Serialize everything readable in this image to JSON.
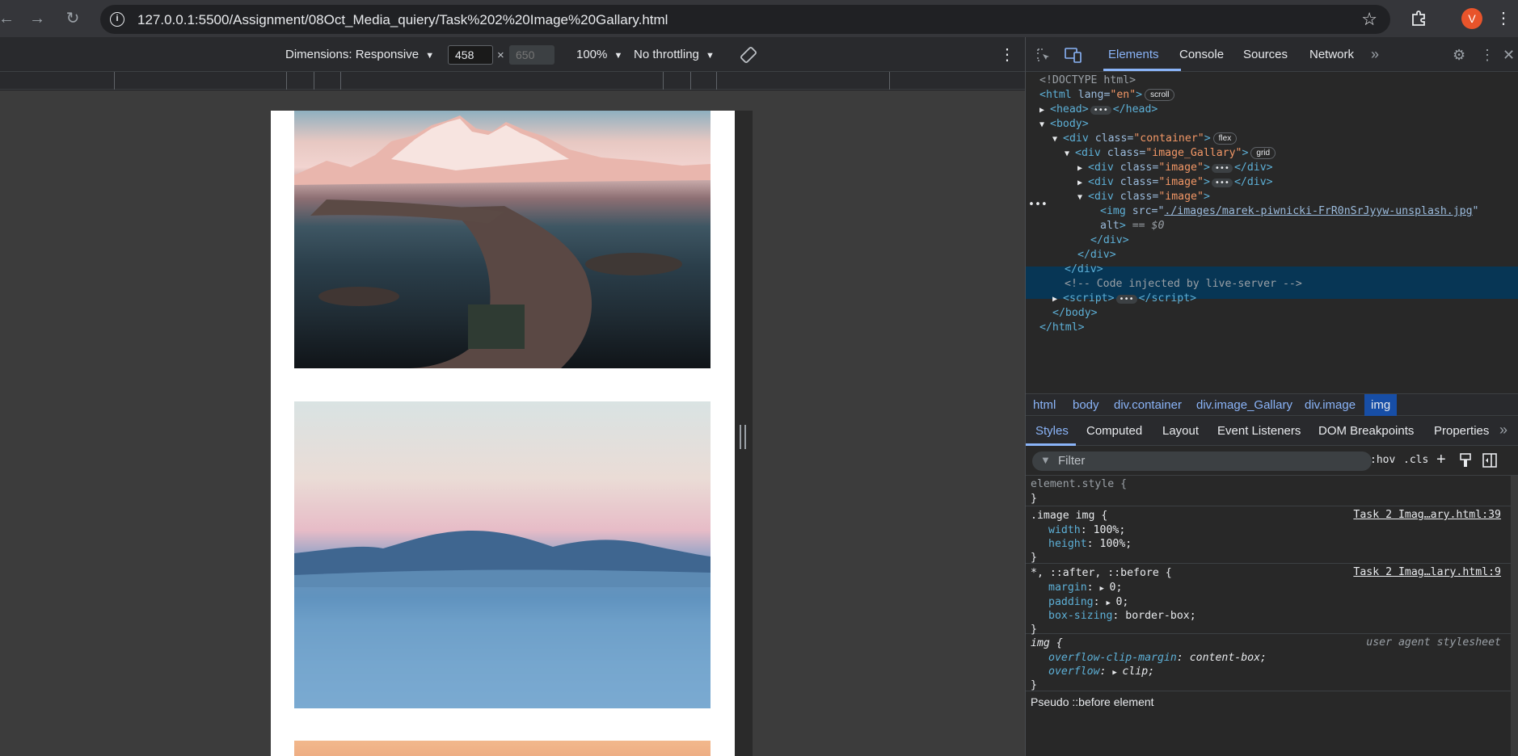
{
  "browser": {
    "url": "127.0.0.1:5500/Assignment/08Oct_Media_quiery/Task%202%20Image%20Gallary.html",
    "avatar_letter": "V",
    "colors": {
      "avatar": "#e8542b",
      "accent": "#8ab4f8"
    }
  },
  "device_toolbar": {
    "dimensions_label": "Dimensions: Responsive",
    "width": "458",
    "height_placeholder": "650",
    "zoom": "100%",
    "throttling": "No throttling"
  },
  "devtools": {
    "tabs": [
      "Elements",
      "Console",
      "Sources",
      "Network"
    ],
    "active_tab": "Elements",
    "dom": {
      "doctype": "<!DOCTYPE html>",
      "html_open": "html",
      "html_lang_attr": "lang",
      "html_lang_val": "\"en\"",
      "html_badge": "scroll",
      "head": "head",
      "body": "body",
      "container_class": "\"container\"",
      "container_badge": "flex",
      "gallery_class": "\"image_Gallary\"",
      "gallery_badge": "grid",
      "image_class": "\"image\"",
      "img_src": "./images/marek-piwnicki-FrR0nSrJyyw-unsplash.jpg",
      "eq": "== $0",
      "comment": "<!-- Code injected by live-server -->",
      "script": "script"
    },
    "breadcrumbs": [
      "html",
      "body",
      "div.container",
      "div.image_Gallary",
      "div.image",
      "img"
    ],
    "styles_tabs": [
      "Styles",
      "Computed",
      "Layout",
      "Event Listeners",
      "DOM Breakpoints",
      "Properties"
    ],
    "filter_placeholder": "Filter",
    "hov": ":hov",
    "cls": ".cls",
    "rules": {
      "element_style": "element.style {",
      "r1_selector": ".image img {",
      "r1_source": "Task 2 Imag…ary.html:39",
      "r1_p1": "width",
      "r1_v1": "100%",
      "r1_p2": "height",
      "r1_v2": "100%",
      "r2_selector": "*, ::after, ::before {",
      "r2_source": "Task 2 Imag…lary.html:9",
      "r2_p1": "margin",
      "r2_v1": "0",
      "r2_p2": "padding",
      "r2_v2": "0",
      "r2_p3": "box-sizing",
      "r2_v3": "border-box",
      "r3_selector": "img {",
      "r3_source": "user agent stylesheet",
      "r3_p1": "overflow-clip-margin",
      "r3_v1": "content-box",
      "r3_p2": "overflow",
      "r3_v2": "clip",
      "pseudo_label": "Pseudo ::before element"
    }
  }
}
